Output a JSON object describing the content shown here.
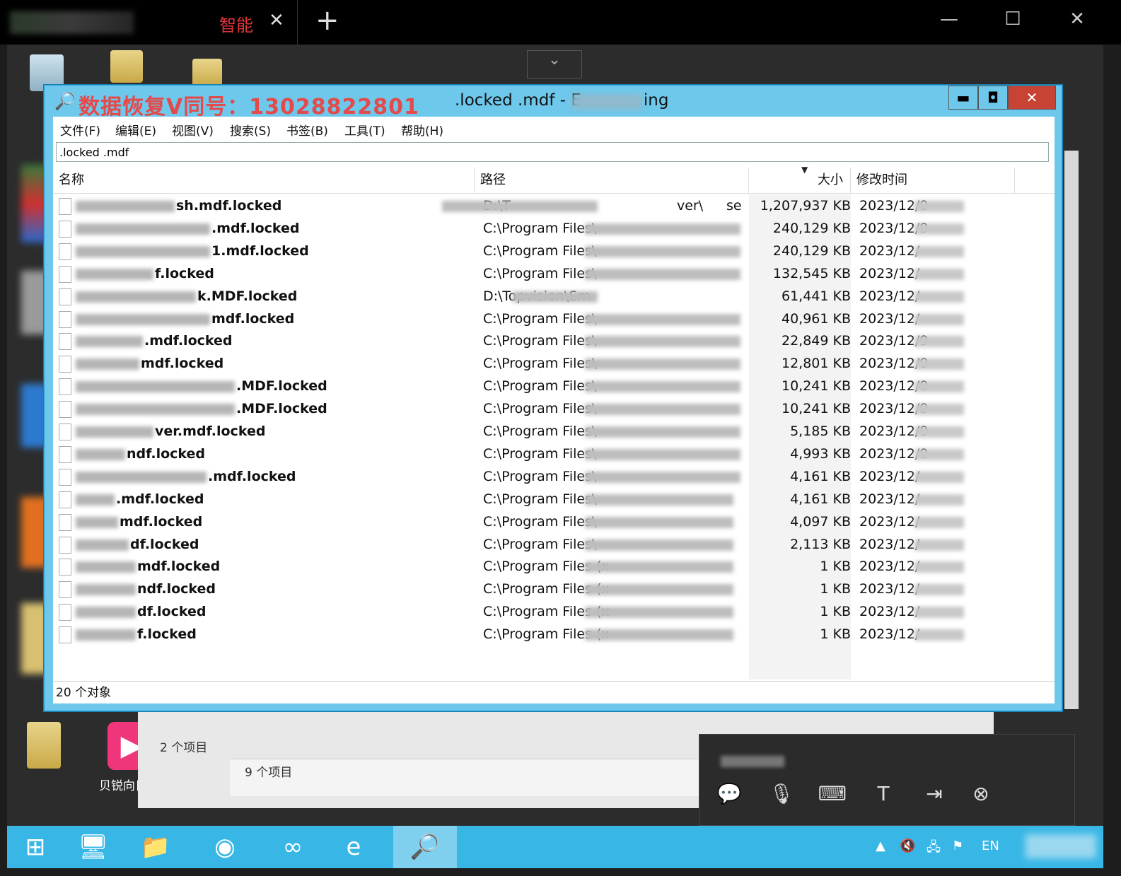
{
  "browser": {
    "tab_title": "智能",
    "tab_close": "✕",
    "new_tab": "+",
    "minimize": "—",
    "maximize": "☐",
    "close": "✕"
  },
  "desktop": {
    "sunflower_label": "贝锐向日葵",
    "explorer_items_1": "2 个项目",
    "explorer_items_2": "9 个项目",
    "collapse_icon": "⌄"
  },
  "app": {
    "watermark": "数据恢复V同号：13028822801",
    "title": ".locked .mdf - E",
    "title_suffix": "ing",
    "buttons": {
      "minimize": "▬",
      "maximize": "◘",
      "close": "✕"
    },
    "menu": [
      "文件(F)",
      "编辑(E)",
      "视图(V)",
      "搜索(S)",
      "书签(B)",
      "工具(T)",
      "帮助(H)"
    ],
    "search_value": ".locked .mdf",
    "columns": {
      "name": "名称",
      "path": "路径",
      "size": "大小",
      "modified": "修改时间"
    },
    "rows": [
      {
        "name": "sh.mdf.locked",
        "path": "D:\\T",
        "path_tail": "ver\\",
        "path_end": "se",
        "size": "1,207,937 KB",
        "date": "2023/12/9"
      },
      {
        "name": ".mdf.locked",
        "path": "C:\\Program Files\\",
        "size": "240,129 KB",
        "date": "2023/12/9"
      },
      {
        "name": "1.mdf.locked",
        "path": "C:\\Program Files\\",
        "size": "240,129 KB",
        "date": "2023/12/"
      },
      {
        "name": "f.locked",
        "path": "C:\\Program Files\\",
        "size": "132,545 KB",
        "date": "2023/12/"
      },
      {
        "name": "k.MDF.locked",
        "path": "D:\\Topvision\\Sm",
        "size": "61,441 KB",
        "date": "2023/12/"
      },
      {
        "name": "mdf.locked",
        "path": "C:\\Program Files\\",
        "size": "40,961 KB",
        "date": "2023/12/"
      },
      {
        "name": ".mdf.locked",
        "path": "C:\\Program Files\\",
        "size": "22,849 KB",
        "date": "2023/12/9"
      },
      {
        "name": "mdf.locked",
        "path": "C:\\Program Files\\",
        "size": "12,801 KB",
        "date": "2023/12/9"
      },
      {
        "name": ".MDF.locked",
        "path": "C:\\Program Files\\",
        "size": "10,241 KB",
        "date": "2023/12/9"
      },
      {
        "name": ".MDF.locked",
        "path": "C:\\Program Files\\",
        "size": "10,241 KB",
        "date": "2023/12/9"
      },
      {
        "name": "ver.mdf.locked",
        "path": "C:\\Program Files\\",
        "size": "5,185 KB",
        "date": "2023/12/9"
      },
      {
        "name": "ndf.locked",
        "path": "C:\\Program Files\\",
        "size": "4,993 KB",
        "date": "2023/12/9"
      },
      {
        "name": ".mdf.locked",
        "path": "C:\\Program Files\\",
        "size": "4,161 KB",
        "date": "2023/12/"
      },
      {
        "name": ".mdf.locked",
        "path": "C:\\Program Files\\",
        "size": "4,161 KB",
        "date": "2023/12/"
      },
      {
        "name": "mdf.locked",
        "path": "C:\\Program Files\\",
        "size": "4,097 KB",
        "date": "2023/12/"
      },
      {
        "name": "df.locked",
        "path": "C:\\Program Files\\",
        "size": "2,113 KB",
        "date": "2023/12/"
      },
      {
        "name": "mdf.locked",
        "path": "C:\\Program Files (x",
        "size": "1 KB",
        "date": "2023/12/"
      },
      {
        "name": "ndf.locked",
        "path": "C:\\Program Files (x",
        "size": "1 KB",
        "date": "2023/12/"
      },
      {
        "name": "df.locked",
        "path": "C:\\Program Files (x",
        "size": "1 KB",
        "date": "2023/12/"
      },
      {
        "name": "f.locked",
        "path": "C:\\Program Files (x",
        "size": "1 KB",
        "date": "2023/12/"
      }
    ],
    "status": "20 个对象"
  },
  "floating_toolbar": {
    "icons": [
      "chat-icon",
      "microphone-icon",
      "keyboard-icon",
      "text-icon",
      "file-transfer-icon",
      "close-icon"
    ]
  },
  "taskbar": {
    "lang": "EN"
  },
  "colors": {
    "title_blue": "#6ec8ec",
    "taskbar_blue": "#38b7e6",
    "watermark_red": "#e44a4a",
    "close_red": "#c84333"
  }
}
